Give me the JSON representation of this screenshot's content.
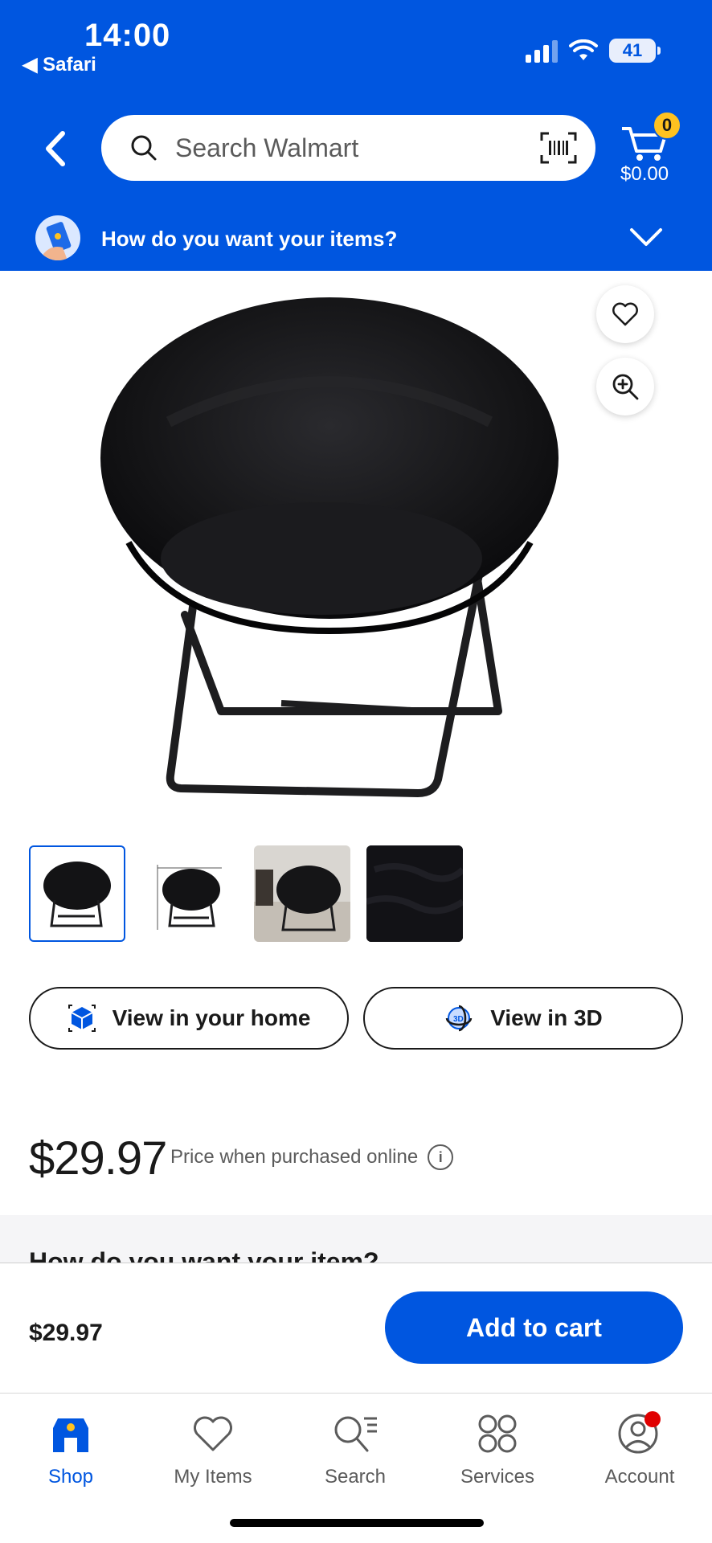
{
  "status_bar": {
    "time": "14:00",
    "back_app": "Safari",
    "battery": "41"
  },
  "header": {
    "search_placeholder": "Search Walmart",
    "cart_count": "0",
    "cart_total": "$0.00",
    "delivery_prompt": "How do you want your items?"
  },
  "product": {
    "thumbnails": [
      "chair-front",
      "chair-dimensions",
      "chair-room",
      "chair-fabric"
    ],
    "view_home_label": "View in your home",
    "view_3d_label": "View in 3D",
    "price": "$29.97",
    "price_note": "Price when purchased online",
    "next_section_heading": "How do you want your item?"
  },
  "bottom_bar": {
    "price": "$29.97",
    "add_to_cart_label": "Add to cart"
  },
  "tabs": [
    {
      "label": "Shop",
      "icon": "shop-icon"
    },
    {
      "label": "My Items",
      "icon": "heart-icon"
    },
    {
      "label": "Search",
      "icon": "search-list-icon"
    },
    {
      "label": "Services",
      "icon": "services-grid-icon"
    },
    {
      "label": "Account",
      "icon": "account-icon"
    }
  ],
  "colors": {
    "brand_blue": "#0056e0",
    "spark_yellow": "#ffc220",
    "notification_red": "#e00000"
  }
}
